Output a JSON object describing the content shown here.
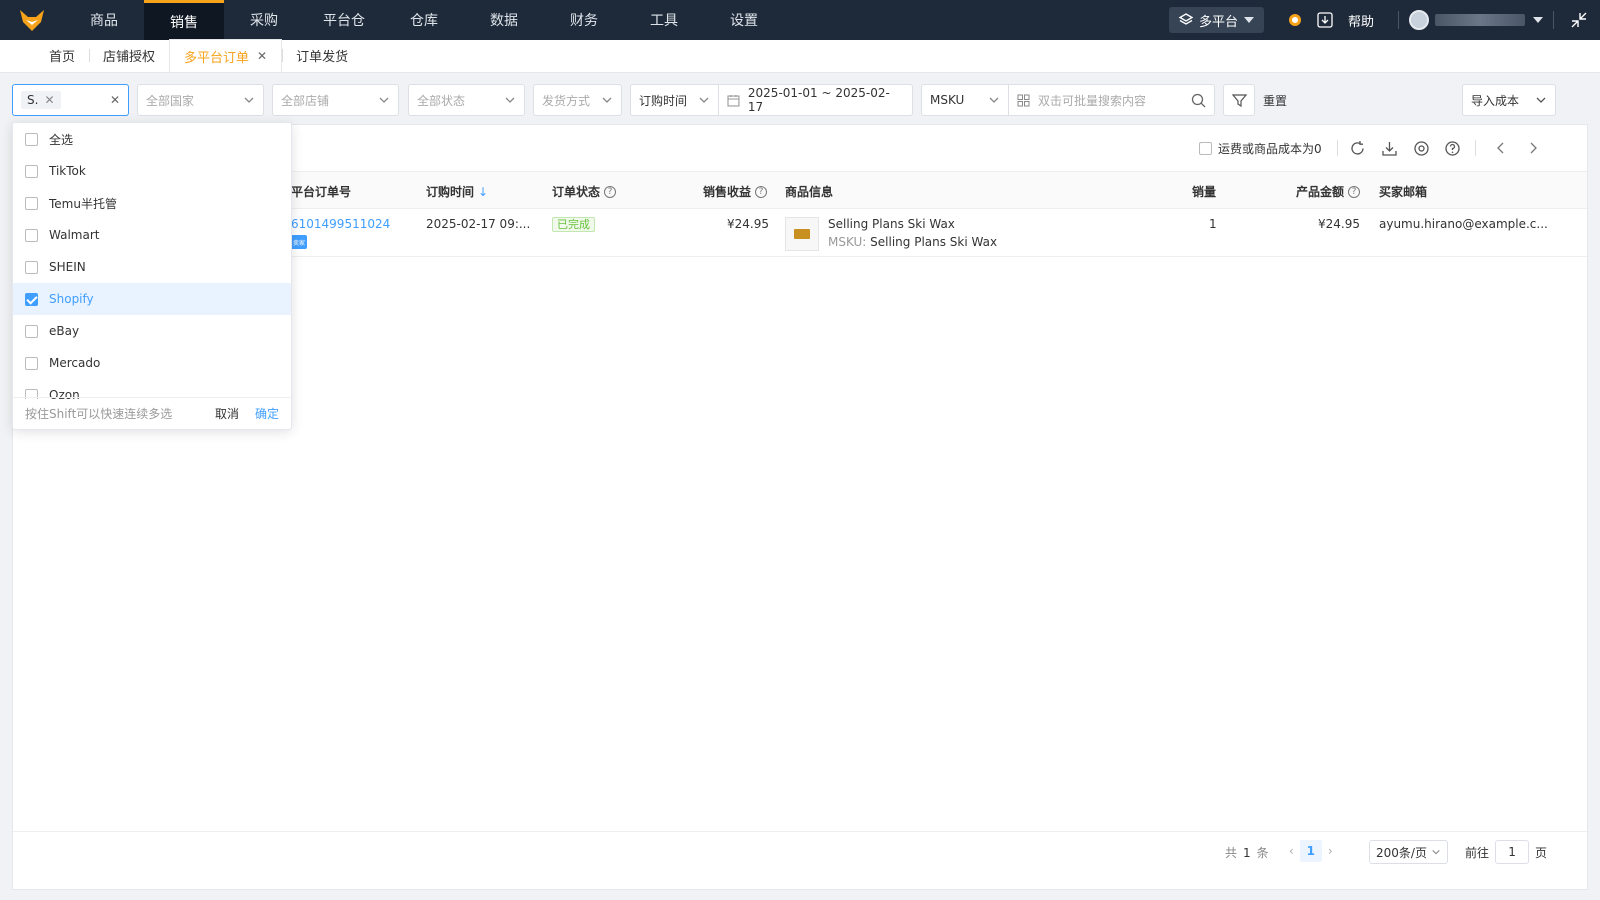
{
  "nav": {
    "items": [
      {
        "label": "商品",
        "active": false
      },
      {
        "label": "销售",
        "active": true
      },
      {
        "label": "采购",
        "active": false
      },
      {
        "label": "平台仓",
        "active": false
      },
      {
        "label": "仓库",
        "active": false
      },
      {
        "label": "数据",
        "active": false
      },
      {
        "label": "财务",
        "active": false
      },
      {
        "label": "工具",
        "active": false
      },
      {
        "label": "设置",
        "active": false
      }
    ],
    "platform_label": "多平台",
    "help_label": "帮助",
    "accent": "#f7a21b",
    "bg": "#1e2a3a"
  },
  "tabs": [
    {
      "label": "首页"
    },
    {
      "label": "店铺授权"
    },
    {
      "label": "多平台订单",
      "active": true
    },
    {
      "label": "订单发货"
    }
  ],
  "filters": {
    "platform_chip": "S.",
    "country_placeholder": "全部国家",
    "store_placeholder": "全部店铺",
    "status_placeholder": "全部状态",
    "shipping_placeholder": "发货方式",
    "time_type": "订购时间",
    "date_range": "2025-01-01 ~ 2025-02-17",
    "search_field": "MSKU",
    "search_placeholder": "双击可批量搜索内容",
    "reset_label": "重置",
    "import_label": "导入成本"
  },
  "toolbar": {
    "zero_cost_label": "运费或商品成本为0"
  },
  "table": {
    "headers": {
      "order_no": "平台订单号",
      "order_time": "订购时间",
      "order_status": "订单状态",
      "revenue": "销售收益",
      "product_info": "商品信息",
      "qty": "销量",
      "amount": "产品金额",
      "buyer_email": "买家邮箱"
    },
    "rows": [
      {
        "order_no": "6101499511024",
        "shop_badge": "卖家",
        "order_time": "2025-02-17 09:...",
        "status": "已完成",
        "revenue": "¥24.95",
        "product_name": "Selling Plans Ski Wax",
        "msku_label": "MSKU:",
        "msku": "Selling Plans Ski Wax",
        "qty": "1",
        "amount": "¥24.95",
        "email": "ayumu.hirano@example.c..."
      }
    ]
  },
  "pager": {
    "total_prefix": "共",
    "total": "1",
    "total_suffix": "条",
    "current": "1",
    "page_size": "200条/页",
    "goto_prefix": "前往",
    "goto_value": "1",
    "goto_suffix": "页"
  },
  "dropdown": {
    "options": [
      {
        "label": "全选",
        "checked": false
      },
      {
        "label": "TikTok",
        "checked": false
      },
      {
        "label": "Temu半托管",
        "checked": false
      },
      {
        "label": "Walmart",
        "checked": false
      },
      {
        "label": "SHEIN",
        "checked": false
      },
      {
        "label": "Shopify",
        "checked": true
      },
      {
        "label": "eBay",
        "checked": false
      },
      {
        "label": "Mercado",
        "checked": false
      },
      {
        "label": "Ozon",
        "checked": false
      }
    ],
    "hint": "按住Shift可以快速连续多选",
    "cancel": "取消",
    "ok": "确定"
  }
}
